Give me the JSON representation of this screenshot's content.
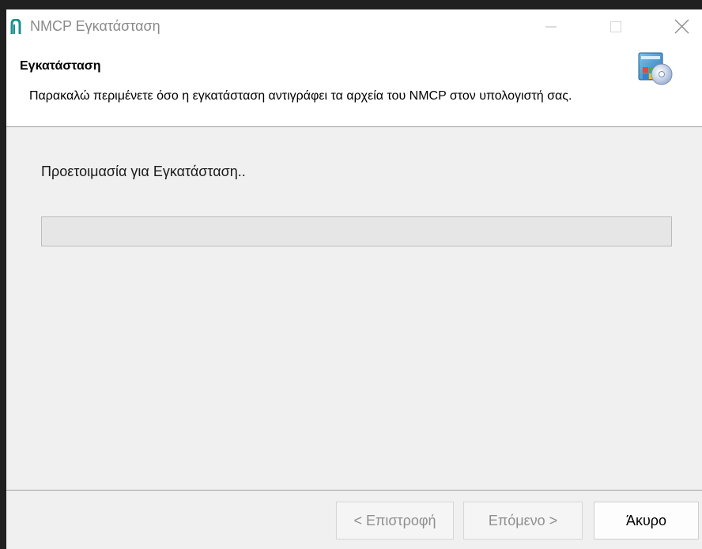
{
  "window": {
    "title": "NMCP Εγκατάσταση"
  },
  "header": {
    "title": "Εγκατάσταση",
    "description": "Παρακαλώ περιμένετε όσο η εγκατάσταση αντιγράφει τα αρχεία του NMCP στον υπολογιστή σας.",
    "icon": "installer-cd-icon"
  },
  "body": {
    "status": "Προετοιμασία για Εγκατάσταση..",
    "progress": 0
  },
  "footer": {
    "back_label": "< Επιστροφή",
    "next_label": "Επόμενο >",
    "cancel_label": "Άκυρο"
  },
  "colors": {
    "app_icon": "#1e8e8e",
    "window_bg": "#f0f0f0",
    "header_bg": "#ffffff",
    "progress_track": "#e6e6e6"
  }
}
